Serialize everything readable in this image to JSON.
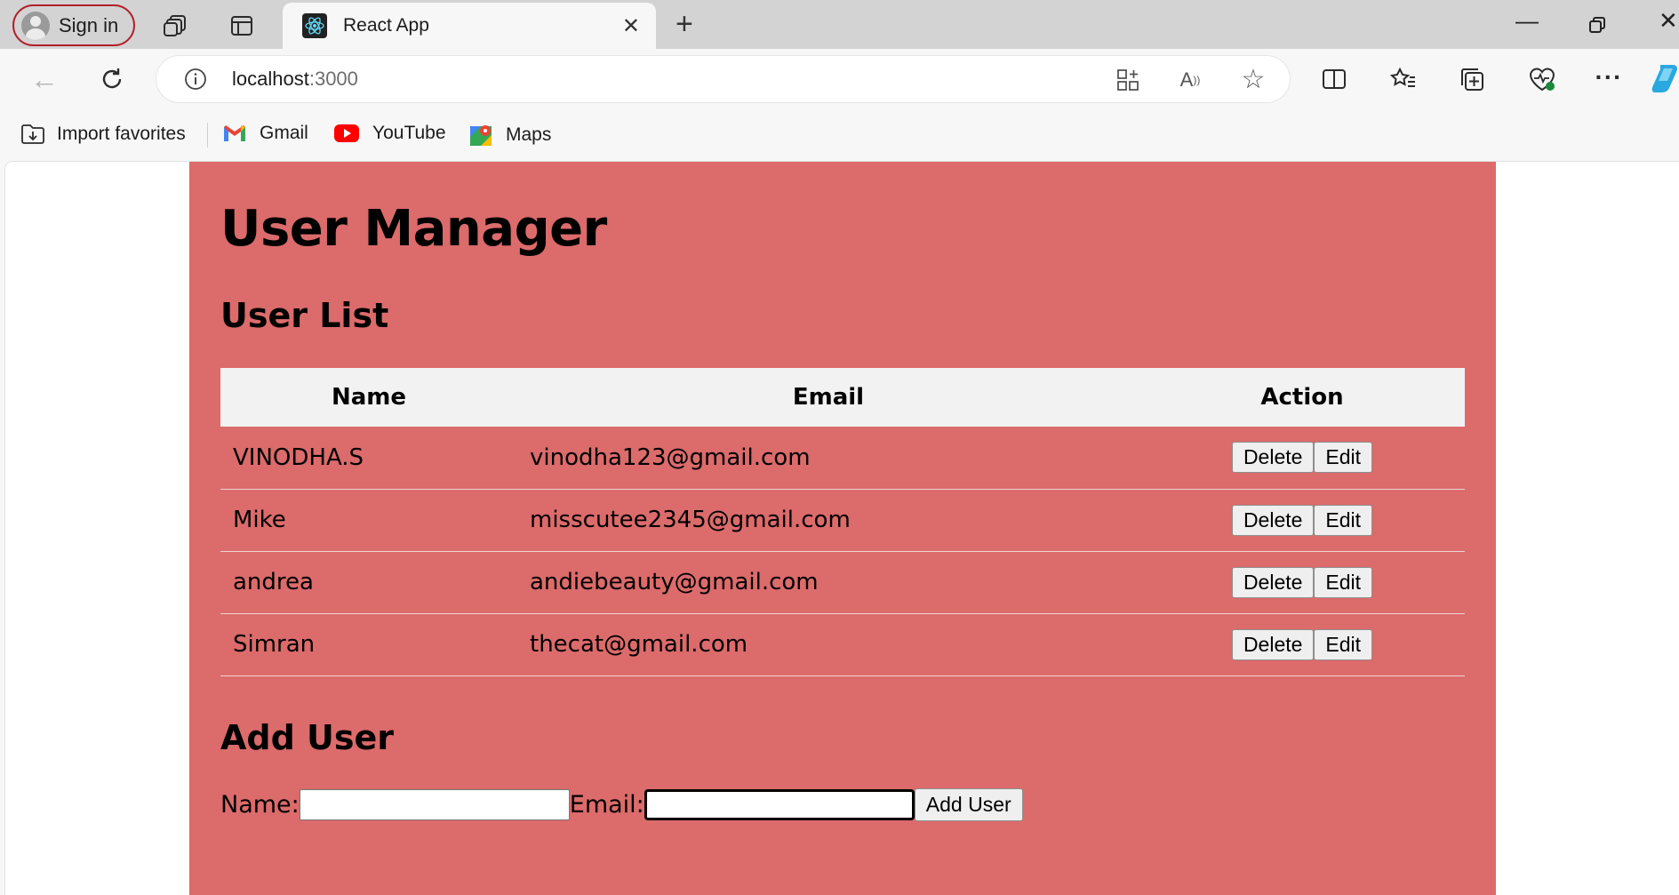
{
  "browser": {
    "signin_label": "Sign in",
    "tab_title": "React App",
    "url_host": "localhost",
    "url_port": ":3000",
    "favorites": [
      {
        "label": "Import favorites"
      },
      {
        "label": "Gmail"
      },
      {
        "label": "YouTube"
      },
      {
        "label": "Maps"
      }
    ]
  },
  "app": {
    "title": "User Manager",
    "list_heading": "User List",
    "columns": [
      "Name",
      "Email",
      "Action"
    ],
    "users": [
      {
        "name": "VINODHA.S",
        "email": "vinodha123@gmail.com"
      },
      {
        "name": "Mike",
        "email": "misscutee2345@gmail.com"
      },
      {
        "name": "andrea",
        "email": "andiebeauty@gmail.com"
      },
      {
        "name": "Simran",
        "email": "thecat@gmail.com"
      }
    ],
    "delete_label": "Delete",
    "edit_label": "Edit",
    "add_heading": "Add User",
    "name_label": "Name:",
    "email_label": "Email:",
    "name_value": "",
    "email_value": "",
    "add_button": "Add User"
  },
  "colors": {
    "app_background": "#dc6b6b",
    "header_row": "#f2f2f2",
    "signin_border": "#b3202a"
  }
}
